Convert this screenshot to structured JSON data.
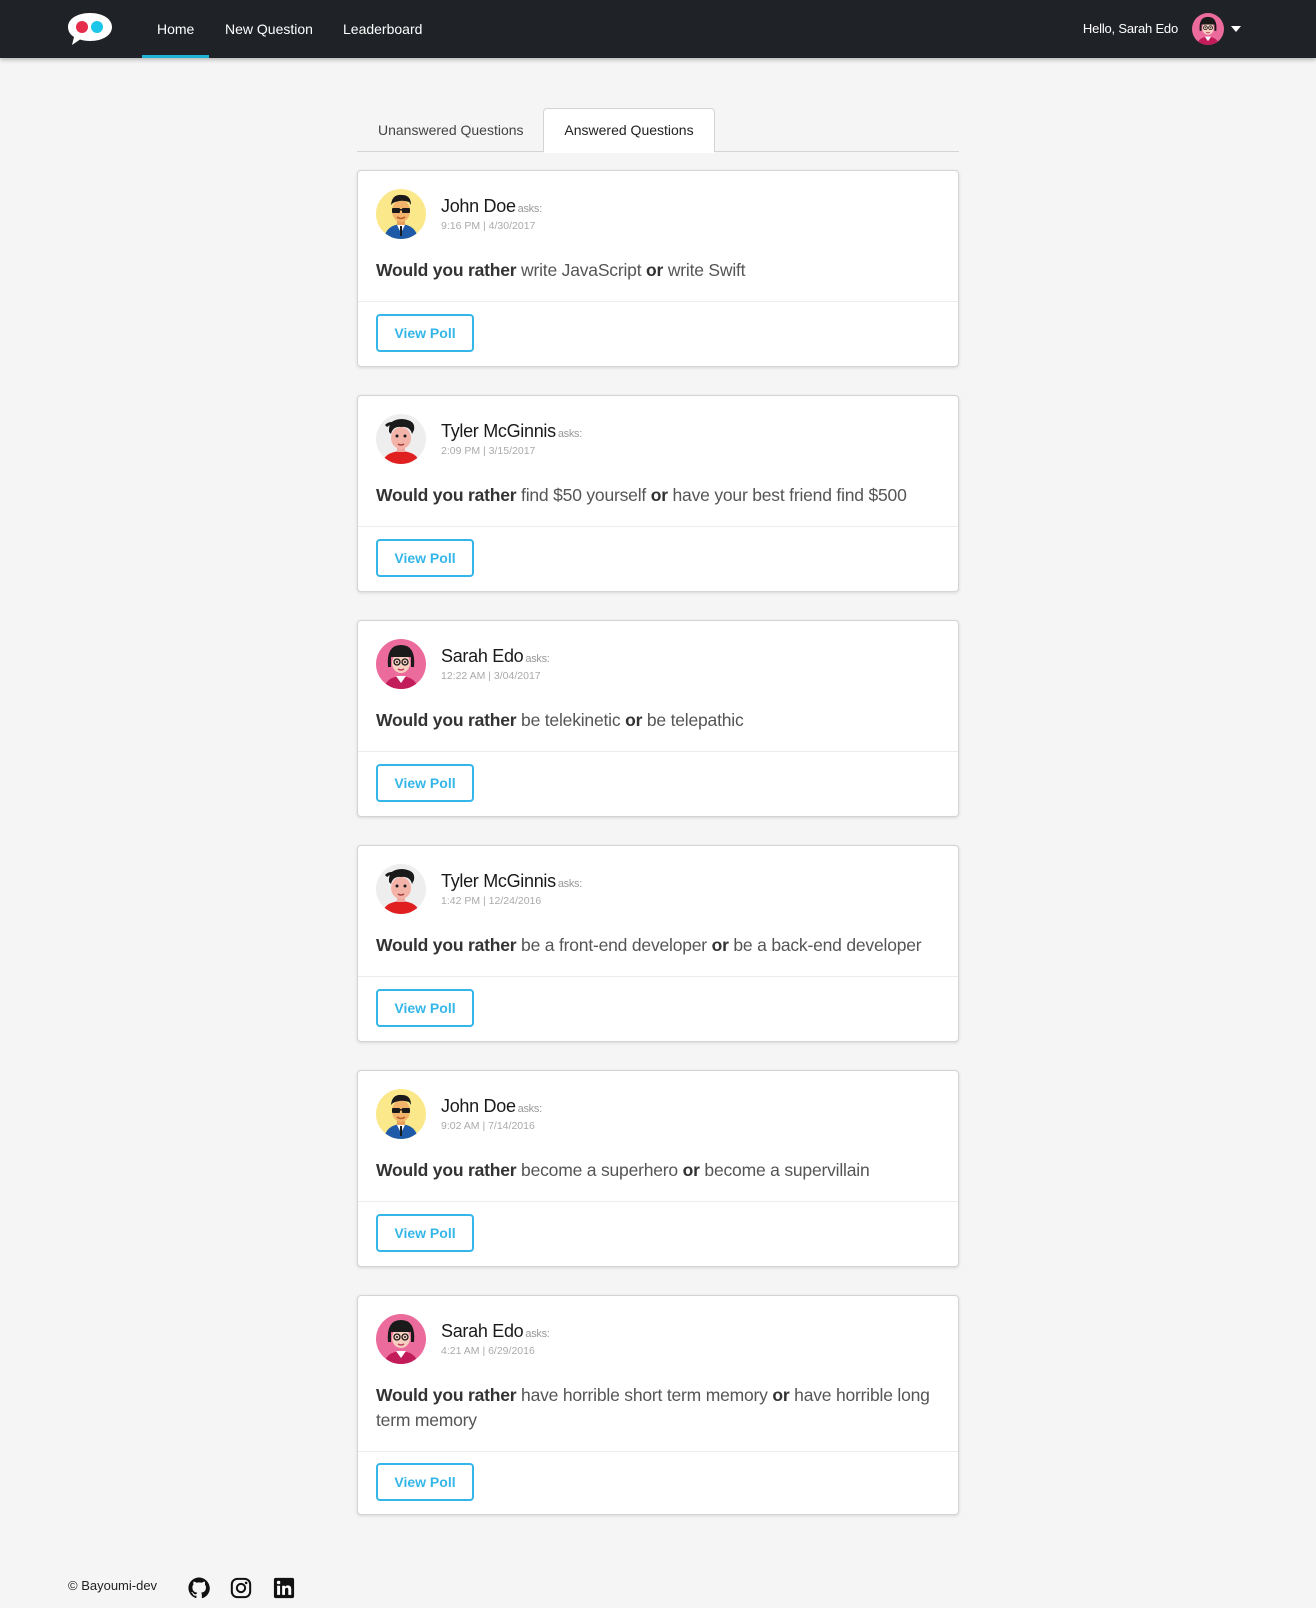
{
  "navbar": {
    "links": [
      {
        "label": "Home"
      },
      {
        "label": "New Question"
      },
      {
        "label": "Leaderboard"
      }
    ],
    "greeting": "Hello, Sarah Edo",
    "colors": {
      "background": "#1f2227",
      "active_indicator": "#1cb5d4",
      "logo_red": "#e52d4b",
      "logo_blue": "#1cc6e8"
    }
  },
  "tabs": {
    "unanswered": "Unanswered Questions",
    "answered": "Answered Questions",
    "selected": "Answered Questions"
  },
  "common": {
    "asks": "asks:",
    "would_you_rather": "Would you rather",
    "or": "or",
    "view_poll": "View Poll",
    "button_color": "#35b6e8"
  },
  "questions": [
    {
      "author": "John Doe",
      "avatar": "john-doe-avatar",
      "date": "9:16 PM | 4/30/2017",
      "option_one": "write JavaScript",
      "option_two": "write Swift"
    },
    {
      "author": "Tyler McGinnis",
      "avatar": "tyler-mcginnis-avatar",
      "date": "2:09 PM | 3/15/2017",
      "option_one": "find $50 yourself",
      "option_two": "have your best friend find $500"
    },
    {
      "author": "Sarah Edo",
      "avatar": "sarah-edo-avatar",
      "date": "12:22 AM | 3/04/2017",
      "option_one": "be telekinetic",
      "option_two": "be telepathic"
    },
    {
      "author": "Tyler McGinnis",
      "avatar": "tyler-mcginnis-avatar",
      "date": "1:42 PM | 12/24/2016",
      "option_one": "be a front-end developer",
      "option_two": "be a back-end developer"
    },
    {
      "author": "John Doe",
      "avatar": "john-doe-avatar",
      "date": "9:02 AM | 7/14/2016",
      "option_one": "become a superhero",
      "option_two": "become a supervillain"
    },
    {
      "author": "Sarah Edo",
      "avatar": "sarah-edo-avatar",
      "date": "4:21 AM | 6/29/2016",
      "option_one": "have horrible short term memory",
      "option_two": "have horrible long term memory"
    }
  ],
  "footer": {
    "copyright": "© Bayoumi-dev",
    "icons": [
      "github-icon",
      "instagram-icon",
      "linkedin-icon"
    ]
  }
}
